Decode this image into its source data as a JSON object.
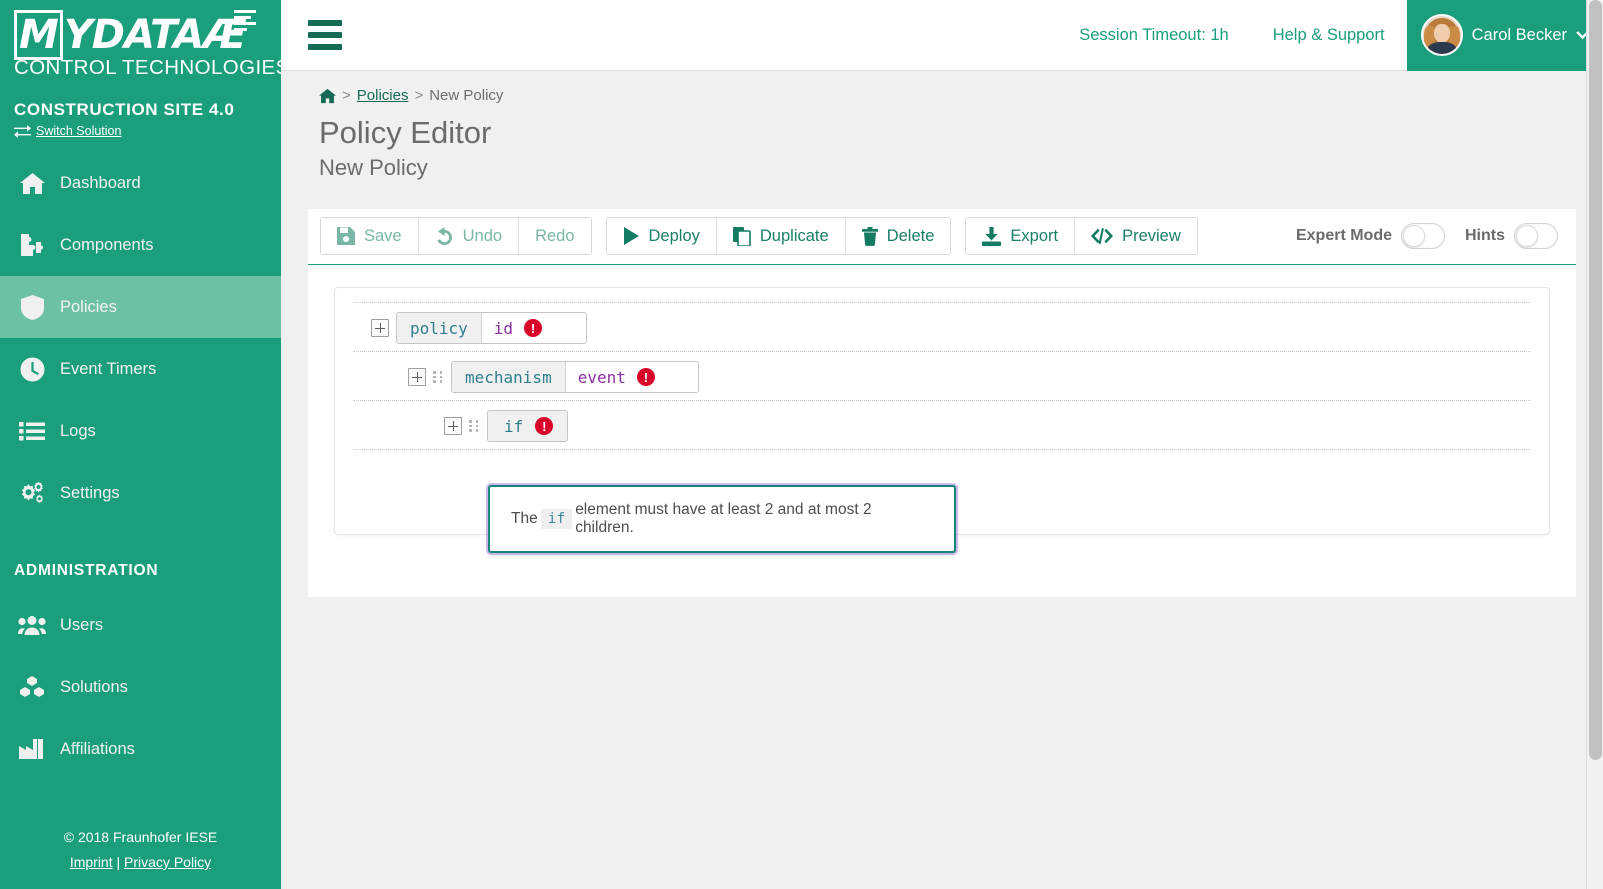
{
  "brand": {
    "logo_main": "MYDATA",
    "logo_sub": "CONTROL TECHNOLOGIES",
    "solution_name": "CONSTRUCTION SITE 4.0",
    "switch_solution": "Switch Solution"
  },
  "sidebar": {
    "items": [
      {
        "label": "Dashboard",
        "icon": "home-icon",
        "active": false
      },
      {
        "label": "Components",
        "icon": "puzzle-icon",
        "active": false
      },
      {
        "label": "Policies",
        "icon": "shield-icon",
        "active": true
      },
      {
        "label": "Event Timers",
        "icon": "clock-icon",
        "active": false
      },
      {
        "label": "Logs",
        "icon": "list-icon",
        "active": false
      },
      {
        "label": "Settings",
        "icon": "gears-icon",
        "active": false
      }
    ],
    "admin_header": "ADMINISTRATION",
    "admin_items": [
      {
        "label": "Users",
        "icon": "users-icon"
      },
      {
        "label": "Solutions",
        "icon": "cubes-icon"
      },
      {
        "label": "Affiliations",
        "icon": "factory-icon"
      }
    ],
    "footer": {
      "copyright": "© 2018 Fraunhofer IESE",
      "imprint": "Imprint",
      "separator": "|",
      "privacy": "Privacy Policy"
    }
  },
  "topbar": {
    "session_timeout": "Session Timeout: 1h",
    "help_support": "Help & Support",
    "user_name": "Carol Becker",
    "user_caret": "⌄"
  },
  "breadcrumb": {
    "home_icon": "home-icon",
    "sep1": ">",
    "policies": "Policies",
    "sep2": ">",
    "current": "New Policy"
  },
  "page": {
    "title": "Policy Editor",
    "subtitle": "New Policy"
  },
  "toolbar": {
    "buttons": [
      {
        "label": "Save",
        "icon": "floppy-disk-icon",
        "enabled": false
      },
      {
        "label": "Undo",
        "icon": "undo-arrow-icon",
        "enabled": false
      },
      {
        "label": "Redo",
        "icon": "redo-arrow-icon",
        "enabled": false
      },
      {
        "label": "Deploy",
        "icon": "play-triangle-icon",
        "enabled": true
      },
      {
        "label": "Duplicate",
        "icon": "copy-icon",
        "enabled": true
      },
      {
        "label": "Delete",
        "icon": "trash-icon",
        "enabled": true
      },
      {
        "label": "Export",
        "icon": "download-icon",
        "enabled": true
      },
      {
        "label": "Preview",
        "icon": "code-brackets-icon",
        "enabled": true
      }
    ],
    "expert_mode_label": "Expert Mode",
    "expert_mode_on": false,
    "hints_label": "Hints",
    "hints_on": false
  },
  "editor": {
    "rows": [
      {
        "tag": "policy",
        "attr": "id",
        "error": true,
        "depth": 0,
        "draggable": false,
        "expandable": true
      },
      {
        "tag": "mechanism",
        "attr": "event",
        "error": true,
        "depth": 1,
        "draggable": true,
        "expandable": true
      },
      {
        "tag": "if",
        "attr": "",
        "error": true,
        "depth": 2,
        "draggable": true,
        "expandable": true
      }
    ],
    "error_badge_glyph": "!",
    "tooltip": {
      "before": "The",
      "code": "if",
      "after": "element must have at least 2 and at most 2 children."
    }
  },
  "colors": {
    "brand_green": "#1a9e7c",
    "active_nav": "#6cc0a4",
    "error_red": "#d90429",
    "tag_teal": "#2d7f90",
    "attr_purple": "#8b2fa0",
    "link_green": "#146b55",
    "page_bg": "#f0f0f0"
  }
}
